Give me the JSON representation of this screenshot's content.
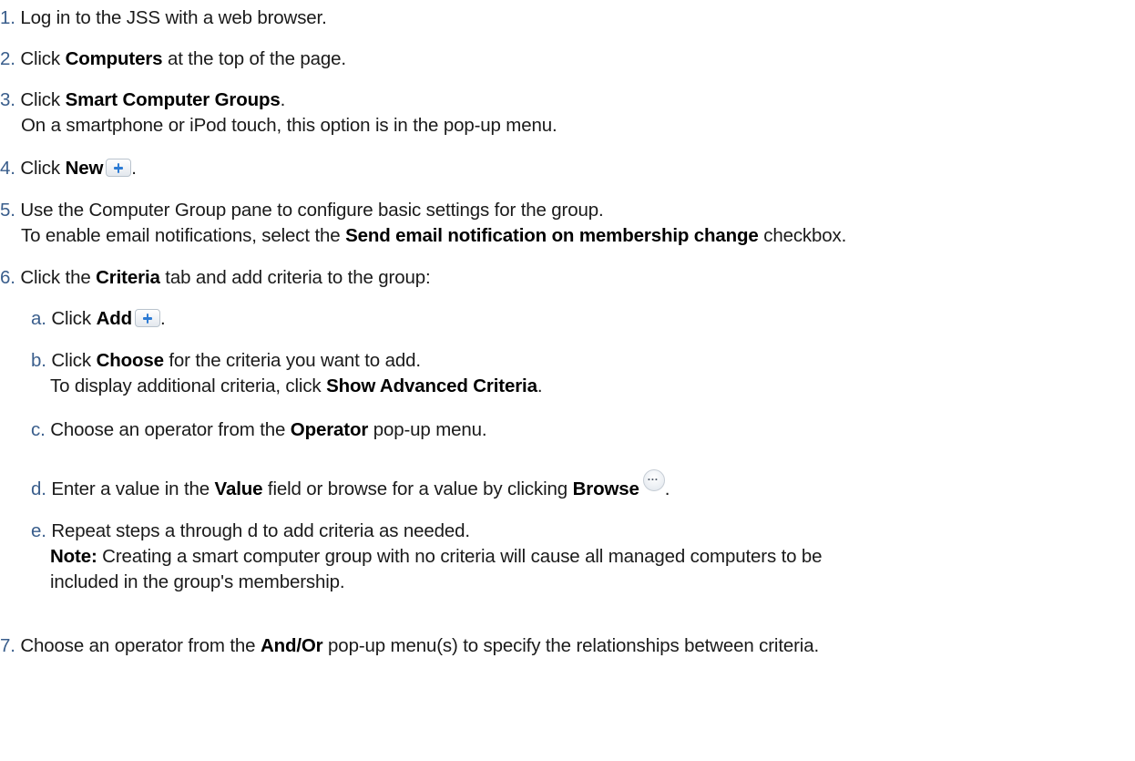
{
  "steps": [
    {
      "num": "1.",
      "text": "Log in to the JSS with a web browser."
    },
    {
      "num": "2.",
      "pre": "Click ",
      "bold": "Computers",
      "post": " at the top of the page."
    },
    {
      "num": "3.",
      "pre": "Click ",
      "bold": "Smart Computer Groups",
      "post": ".",
      "line2": "On a smartphone or iPod touch, this option is in the pop-up menu."
    },
    {
      "num": "4.",
      "pre": "Click ",
      "bold": "New",
      "post": "."
    },
    {
      "num": "5.",
      "text": "Use the Computer Group pane to configure basic settings for the group.",
      "line2_pre": "To enable email notifications, select the ",
      "line2_bold": "Send email notification on membership change",
      "line2_post": " checkbox."
    },
    {
      "num": "6.",
      "pre": "Click the ",
      "bold": "Criteria",
      "post": " tab and add criteria to the group:"
    },
    {
      "num": "7.",
      "pre": "Choose an operator from the ",
      "bold": "And/Or",
      "post": " pop-up menu(s) to specify the relationships between criteria."
    }
  ],
  "substeps": [
    {
      "letter": "a.",
      "pre": "Click ",
      "bold": "Add",
      "post": "."
    },
    {
      "letter": "b.",
      "pre": "Click ",
      "bold": "Choose",
      "post": " for the criteria you want to add.",
      "line2_pre": "To display additional criteria, click ",
      "line2_bold": "Show Advanced Criteria",
      "line2_post": "."
    },
    {
      "letter": "c.",
      "pre": "Choose an operator from the ",
      "bold": "Operator",
      "post": " pop-up menu."
    },
    {
      "letter": "d.",
      "pre": "Enter a value in the ",
      "bold": "Value",
      "mid": " field or browse for a value by clicking ",
      "bold2": "Browse",
      "post": "."
    },
    {
      "letter": "e.",
      "text": "Repeat steps a through d to add criteria as needed.",
      "note_label": "Note:",
      "note_text": " Creating a smart computer group with no criteria will cause all managed computers to be",
      "note_line3": "included in the group's membership."
    }
  ],
  "icons": {
    "add": "plus-button-icon",
    "browse": "ellipsis-button-icon"
  },
  "colors": {
    "number": "#3a5e8c",
    "button_plus": "#2d7bd4"
  }
}
